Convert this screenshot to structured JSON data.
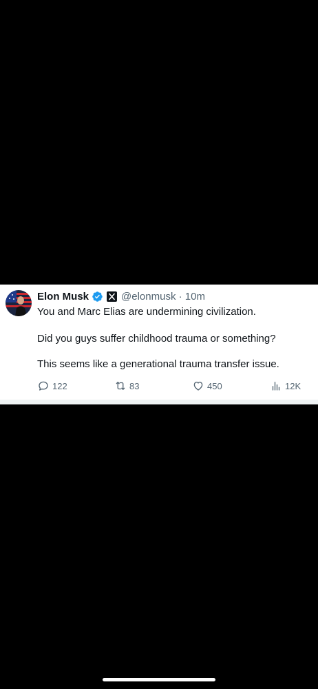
{
  "tweet": {
    "author": {
      "display_name": "Elon Musk",
      "handle": "@elonmusk",
      "time": "10m",
      "separator": "·",
      "verified_icon": "verified-badge-icon",
      "affiliate_icon": "x-affiliate-icon"
    },
    "text_lines": [
      "You and Marc Elias are undermining civilization.",
      "Did you guys suffer childhood trauma or something?",
      "This seems like a generational trauma transfer issue."
    ],
    "actions": {
      "replies": "122",
      "retweets": "83",
      "likes": "450",
      "views": "12K"
    }
  },
  "colors": {
    "text_primary": "#0f1419",
    "text_secondary": "#536471",
    "verified_blue": "#1d9bf0",
    "background": "#000000",
    "card": "#ffffff"
  }
}
